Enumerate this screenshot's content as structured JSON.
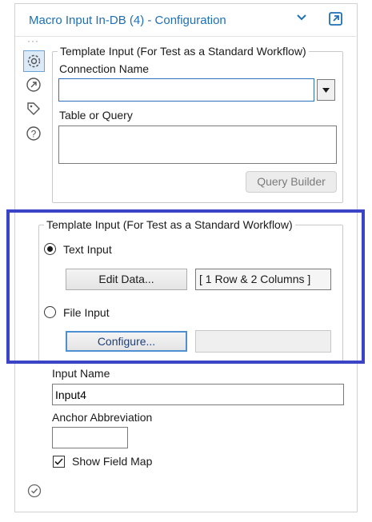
{
  "window": {
    "title": "Macro Input In-DB (4) - Configuration"
  },
  "sidebar": {
    "icons": [
      "gear-icon",
      "connection-icon",
      "tag-icon",
      "help-icon"
    ]
  },
  "template_input_top": {
    "legend": "Template Input (For Test as a Standard Workflow)",
    "connection_name_label": "Connection Name",
    "connection_name_value": "",
    "table_or_query_label": "Table or Query",
    "table_or_query_value": "",
    "query_builder_label": "Query Builder"
  },
  "template_input_bottom": {
    "legend": "Template Input (For Test as a Standard Workflow)",
    "text_input_label": "Text Input",
    "text_input_selected": true,
    "edit_data_label": "Edit Data...",
    "data_summary": "[ 1 Row & 2 Columns ]",
    "file_input_label": "File Input",
    "file_input_selected": false,
    "configure_label": "Configure...",
    "file_path_value": ""
  },
  "input_name": {
    "label": "Input Name",
    "value": "Input4"
  },
  "anchor": {
    "label": "Anchor Abbreviation",
    "value": ""
  },
  "show_field_map": {
    "label": "Show Field Map",
    "checked": true
  },
  "colors": {
    "title": "#1f6fb5",
    "highlight_border": "#3b44c6",
    "active_icon_bg": "#dce9f7"
  }
}
